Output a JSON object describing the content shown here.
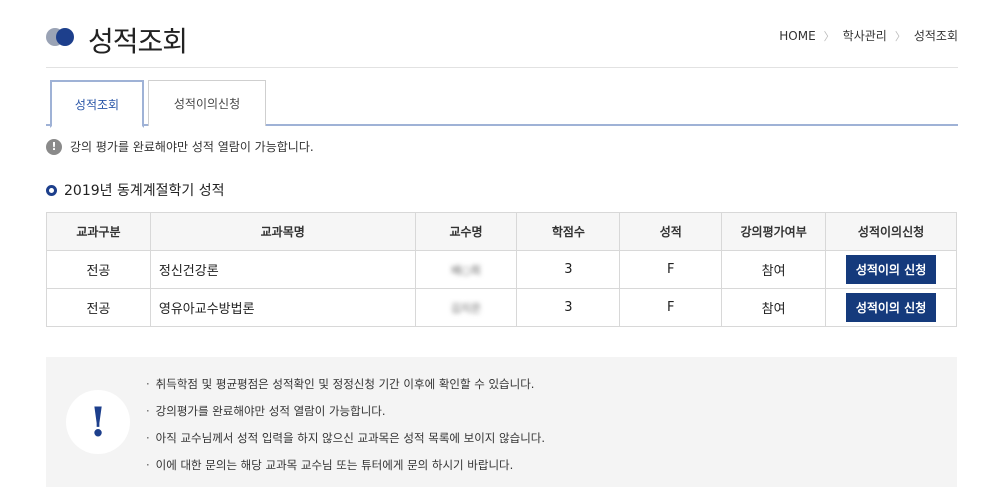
{
  "header": {
    "title": "성적조회",
    "breadcrumb": [
      "HOME",
      "학사관리",
      "성적조회"
    ]
  },
  "tabs": [
    {
      "label": "성적조회",
      "active": true
    },
    {
      "label": "성적이의신청",
      "active": false
    }
  ],
  "notice": "강의 평가를 완료해야만 성적 열람이 가능합니다.",
  "section_title": "2019년 동계계절학기 성적",
  "table": {
    "headers": [
      "교과구분",
      "교과목명",
      "교수명",
      "학점수",
      "성적",
      "강의평가여부",
      "성적이의신청"
    ],
    "rows": [
      {
        "category": "전공",
        "course": "정신건강론",
        "professor": "배○희",
        "credits": "3",
        "grade": "F",
        "evaluation": "참여",
        "button": "성적이의 신청"
      },
      {
        "category": "전공",
        "course": "영유아교수방법론",
        "professor": "김지은",
        "credits": "3",
        "grade": "F",
        "evaluation": "참여",
        "button": "성적이의 신청"
      }
    ]
  },
  "info": {
    "items": [
      "취득학점 및 평균평점은 성적확인 및 정정신청 기간 이후에 확인할 수 있습니다.",
      "강의평가를 완료해야만 성적 열람이 가능합니다.",
      "아직 교수님께서 성적 입력을 하지 않으신 교과목은 성적 목록에 보이지 않습니다.",
      "이에 대한 문의는 해당 교과목 교수님 또는 튜터에게 문의 하시기 바랍니다."
    ]
  },
  "colors": {
    "accent": "#1d3f8c",
    "button": "#153a7c",
    "tab_border": "#9fb2d6"
  }
}
